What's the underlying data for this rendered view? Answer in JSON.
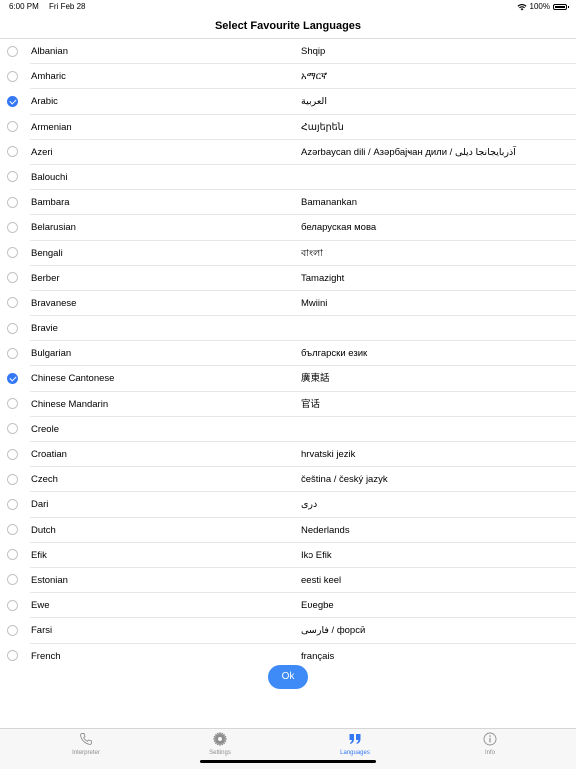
{
  "status": {
    "time": "6:00 PM",
    "date": "Fri Feb 28",
    "battery": "100%"
  },
  "title": "Select Favourite Languages",
  "languages": [
    {
      "name": "Albanian",
      "native": "Shqip",
      "selected": false
    },
    {
      "name": "Amharic",
      "native": "አማርኛ",
      "selected": false
    },
    {
      "name": "Arabic",
      "native": "العربية",
      "selected": true
    },
    {
      "name": "Armenian",
      "native": "Հայերեն",
      "selected": false
    },
    {
      "name": "Azeri",
      "native": "Azərbaycan dili / Азәрбајҹан дили / آذربایجانجا دیلی",
      "selected": false
    },
    {
      "name": "Balouchi",
      "native": "",
      "selected": false
    },
    {
      "name": "Bambara",
      "native": "Bamanankan",
      "selected": false
    },
    {
      "name": "Belarusian",
      "native": "беларуская мова",
      "selected": false
    },
    {
      "name": "Bengali",
      "native": "বাংলা",
      "selected": false
    },
    {
      "name": "Berber",
      "native": "Tamazight",
      "selected": false
    },
    {
      "name": "Bravanese",
      "native": "Mwiini",
      "selected": false
    },
    {
      "name": "Bravie",
      "native": "",
      "selected": false
    },
    {
      "name": "Bulgarian",
      "native": "български език",
      "selected": false
    },
    {
      "name": "Chinese Cantonese",
      "native": "廣東話",
      "selected": true
    },
    {
      "name": "Chinese Mandarin",
      "native": "官话",
      "selected": false
    },
    {
      "name": "Creole",
      "native": "",
      "selected": false
    },
    {
      "name": "Croatian",
      "native": "hrvatski jezik",
      "selected": false
    },
    {
      "name": "Czech",
      "native": "čeština / český jazyk",
      "selected": false
    },
    {
      "name": "Dari",
      "native": "دری",
      "selected": false
    },
    {
      "name": "Dutch",
      "native": "Nederlands",
      "selected": false
    },
    {
      "name": "Efik",
      "native": "Ikɔ Efik",
      "selected": false
    },
    {
      "name": "Estonian",
      "native": "eesti keel",
      "selected": false
    },
    {
      "name": "Ewe",
      "native": "Eʋegbe",
      "selected": false
    },
    {
      "name": "Farsi",
      "native": "فارسی / форсӣ",
      "selected": false
    },
    {
      "name": "French",
      "native": "français",
      "selected": false
    }
  ],
  "ok_label": "Ok",
  "tabs": [
    {
      "label": "Interpreter",
      "icon": "phone-icon",
      "active": false
    },
    {
      "label": "Settings",
      "icon": "gear-icon",
      "active": false
    },
    {
      "label": "Languages",
      "icon": "quote-icon",
      "active": true
    },
    {
      "label": "Info",
      "icon": "info-icon",
      "active": false
    }
  ],
  "colors": {
    "accent": "#3478f6",
    "ok_button": "#3e8bf7"
  }
}
